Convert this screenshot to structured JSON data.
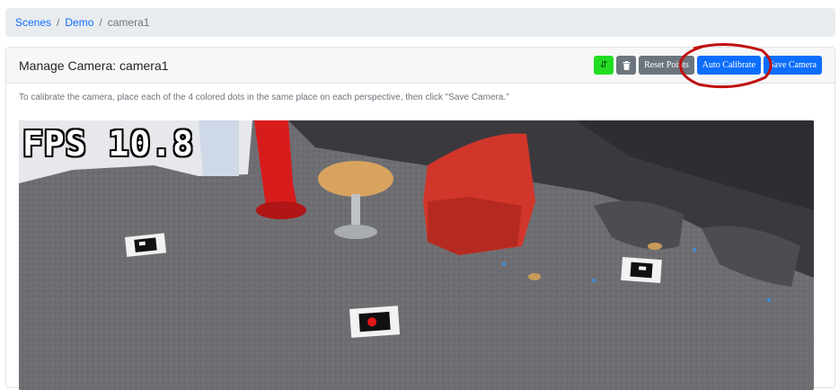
{
  "breadcrumb": {
    "items": [
      "Scenes",
      "Demo"
    ],
    "current": "camera1",
    "separator": "/"
  },
  "header": {
    "title": "Manage Camera: camera1"
  },
  "toolbar": {
    "swap_icon": "⇵",
    "reset_label": "Reset Points",
    "auto_calibrate_label": "Auto Calibrate",
    "save_label": "Save Camera"
  },
  "instructions": "To calibrate the camera, place each of the 4 colored dots in the same place on each perspective, then click \"Save Camera.\"",
  "video": {
    "fps_text": "FPS 10.8"
  },
  "colors": {
    "accent": "#0d6efd",
    "green_button": "#22dd22",
    "annotation": "#c01010"
  }
}
